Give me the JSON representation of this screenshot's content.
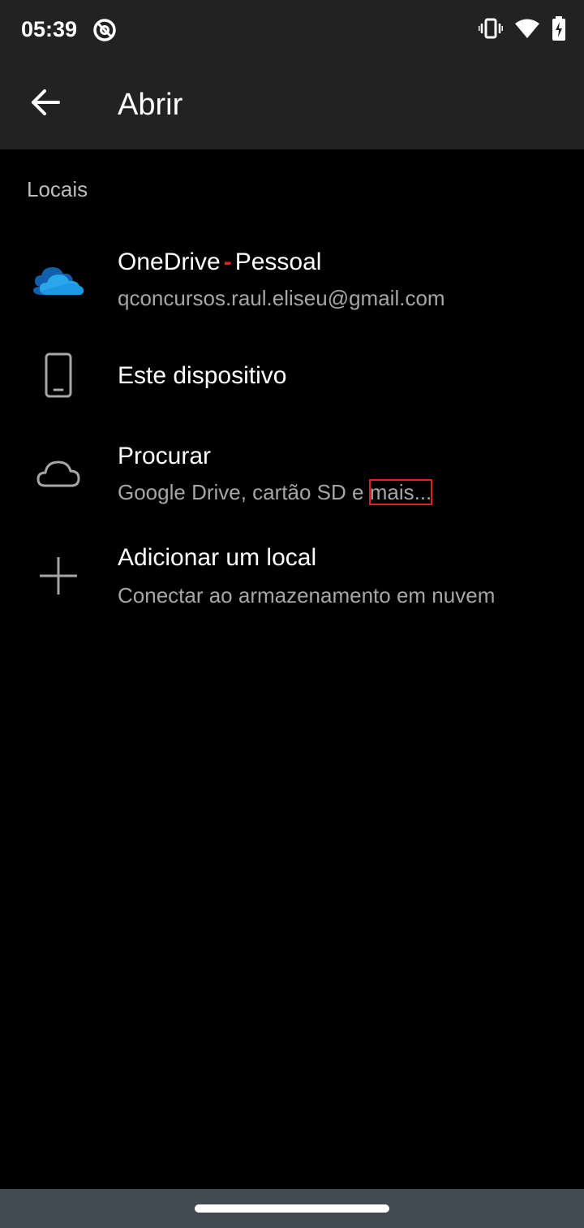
{
  "status_bar": {
    "time": "05:39",
    "left_icon": "at-sign-icon",
    "right_icons": [
      "vibrate-icon",
      "wifi-icon",
      "battery-charging-icon"
    ]
  },
  "app_bar": {
    "back_icon": "arrow-back-icon",
    "title": "Abrir"
  },
  "section": {
    "header": "Locais"
  },
  "locations": [
    {
      "icon": "onedrive-cloud-icon",
      "title_main": "OneDrive",
      "title_sep": "-",
      "title_suffix": "Pessoal",
      "subtitle": "qconcursos.raul.eliseu@gmail.com"
    },
    {
      "icon": "phone-icon",
      "title": "Este dispositivo"
    },
    {
      "icon": "cloud-outline-icon",
      "title": "Procurar",
      "subtitle_main": "Google Drive, cartão SD e ",
      "subtitle_link": "mais..."
    },
    {
      "icon": "plus-icon",
      "title": "Adicionar um local",
      "subtitle": "Conectar ao armazenamento em nuvem"
    }
  ],
  "colors": {
    "background": "#000000",
    "bar": "#222222",
    "onedrive_blue": "#0f78d4",
    "accent_red": "#e0211b",
    "nav_bar": "#424a52"
  }
}
